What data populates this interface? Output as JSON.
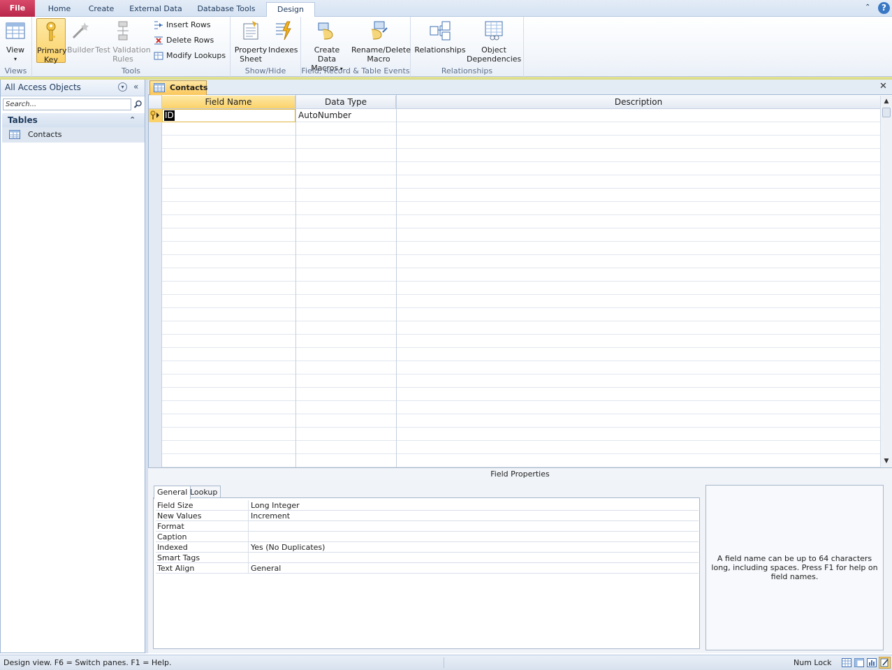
{
  "tabs": {
    "file": "File",
    "home": "Home",
    "create": "Create",
    "external_data": "External Data",
    "database_tools": "Database Tools",
    "design": "Design"
  },
  "ribbon": {
    "views": {
      "label": "Views",
      "view": "View"
    },
    "tools": {
      "label": "Tools",
      "primary_key_1": "Primary",
      "primary_key_2": "Key",
      "builder": "Builder",
      "test_1": "Test Validation",
      "test_2": "Rules",
      "insert_rows": "Insert Rows",
      "delete_rows": "Delete Rows",
      "modify_lookups": "Modify Lookups"
    },
    "show_hide": {
      "label": "Show/Hide",
      "property_1": "Property",
      "property_2": "Sheet",
      "indexes": "Indexes"
    },
    "events": {
      "label": "Field, Record & Table Events",
      "create_1": "Create Data",
      "create_2": "Macros",
      "rename_1": "Rename/Delete",
      "rename_2": "Macro"
    },
    "relationships": {
      "label": "Relationships",
      "rel": "Relationships",
      "obj_1": "Object",
      "obj_2": "Dependencies"
    }
  },
  "nav": {
    "title": "All Access Objects",
    "search_placeholder": "Search...",
    "section": "Tables",
    "items": [
      "Contacts"
    ]
  },
  "document": {
    "tab": "Contacts",
    "columns": [
      "Field Name",
      "Data Type",
      "Description"
    ],
    "rows": [
      {
        "field": "ID",
        "type": "AutoNumber",
        "desc": ""
      }
    ]
  },
  "field_properties": {
    "title": "Field Properties",
    "tabs": [
      "General",
      "Lookup"
    ],
    "props": [
      {
        "name": "Field Size",
        "value": "Long Integer"
      },
      {
        "name": "New Values",
        "value": "Increment"
      },
      {
        "name": "Format",
        "value": ""
      },
      {
        "name": "Caption",
        "value": ""
      },
      {
        "name": "Indexed",
        "value": "Yes (No Duplicates)"
      },
      {
        "name": "Smart Tags",
        "value": ""
      },
      {
        "name": "Text Align",
        "value": "General"
      }
    ],
    "help": "A field name can be up to 64 characters long, including spaces. Press F1 for help on field names."
  },
  "status": {
    "left": "Design view.  F6 = Switch panes.  F1 = Help.",
    "right": "Num Lock"
  },
  "colors": {
    "accent": "#fbd26a",
    "file_tab": "#c0315a",
    "ribbon_border": "#b6c8e0"
  }
}
